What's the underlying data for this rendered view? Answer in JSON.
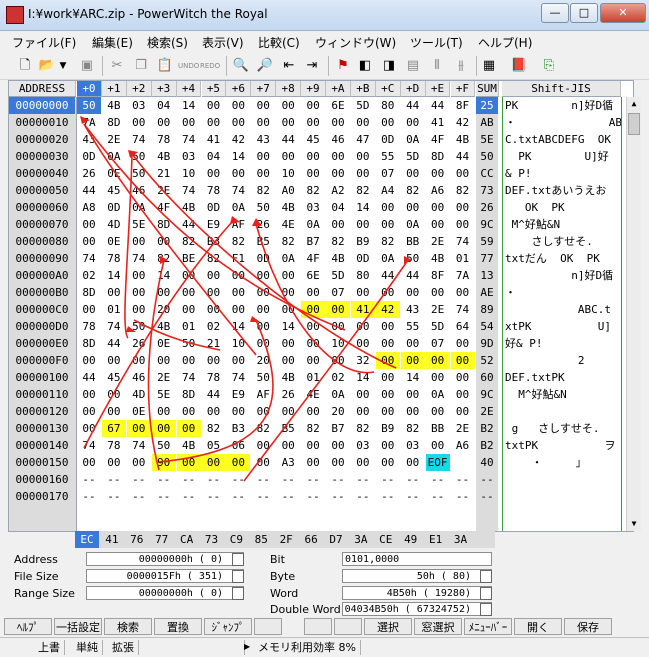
{
  "title": "I:¥work¥ARC.zip - PowerWitch the Royal",
  "window_buttons": [
    "—",
    "□",
    "✕"
  ],
  "menu": [
    "ファイル(F)",
    "編集(E)",
    "検索(S)",
    "表示(V)",
    "比較(C)",
    "ウィンドウ(W)",
    "ツール(T)",
    "ヘルプ(H)"
  ],
  "toolbar_icons": [
    "new-file-icon",
    "open-file-icon",
    "dropdown-icon",
    "save-icon",
    "cut-icon",
    "copy-icon",
    "paste-icon",
    "undo-icon",
    "redo-icon",
    "find-icon",
    "find-replace-icon",
    "find-prev-icon",
    "find-next-icon",
    "bookmark-add-icon",
    "bookmark-prev-icon",
    "bookmark-next-icon",
    "bookmark-clear-icon",
    "compare-icon",
    "compare-next-icon",
    "calculator-icon",
    "book-icon",
    "exit-icon"
  ],
  "undo_label": "UNDO",
  "redo_label": "REDO",
  "header": {
    "address": "ADDRESS",
    "columns": [
      "+0",
      "+1",
      "+2",
      "+3",
      "+4",
      "+5",
      "+6",
      "+7",
      "+8",
      "+9",
      "+A",
      "+B",
      "+C",
      "+D",
      "+E",
      "+F"
    ],
    "sum": "SUM",
    "sjis": "Shift-JIS"
  },
  "rows": [
    {
      "addr": "00000000",
      "bytes": [
        "50",
        "4B",
        "03",
        "04",
        "14",
        "00",
        "00",
        "00",
        "00",
        "00",
        "6E",
        "5D",
        "80",
        "44",
        "44",
        "8F"
      ],
      "sum": "25",
      "sjis": "PK        n]好D循"
    },
    {
      "addr": "00000010",
      "bytes": [
        "7A",
        "8D",
        "00",
        "00",
        "00",
        "00",
        "00",
        "00",
        "00",
        "00",
        "00",
        "00",
        "00",
        "00",
        "41",
        "42"
      ],
      "sum": "AB",
      "sjis": "・              AB"
    },
    {
      "addr": "00000020",
      "bytes": [
        "43",
        "2E",
        "74",
        "78",
        "74",
        "41",
        "42",
        "43",
        "44",
        "45",
        "46",
        "47",
        "0D",
        "0A",
        "4F",
        "4B"
      ],
      "sum": "5E",
      "sjis": "C.txtABCDEFG  OK"
    },
    {
      "addr": "00000030",
      "bop": "",
      "bytes": [
        "0D",
        "0A",
        "50",
        "4B",
        "03",
        "04",
        "14",
        "00",
        "00",
        "00",
        "00",
        "00",
        "55",
        "5D",
        "8D",
        "44"
      ],
      "sum": "50",
      "sjis": "  PK        U]好"
    },
    {
      "addr": "00000040",
      "bytes": [
        "26",
        "0E",
        "50",
        "21",
        "10",
        "00",
        "00",
        "00",
        "10",
        "00",
        "00",
        "00",
        "07",
        "00",
        "00",
        "00"
      ],
      "sum": "CC",
      "sjis": "& P!"
    },
    {
      "addr": "00000050",
      "bytes": [
        "44",
        "45",
        "46",
        "2E",
        "74",
        "78",
        "74",
        "82",
        "A0",
        "82",
        "A2",
        "82",
        "A4",
        "82",
        "A6",
        "82"
      ],
      "sum": "73",
      "sjis": "DEF.txtあいうえお"
    },
    {
      "addr": "00000060",
      "bytes": [
        "A8",
        "0D",
        "0A",
        "4F",
        "4B",
        "0D",
        "0A",
        "50",
        "4B",
        "03",
        "04",
        "14",
        "00",
        "00",
        "00",
        "00"
      ],
      "sum": "26",
      "sjis": "   OK  PK"
    },
    {
      "addr": "00000070",
      "bytes": [
        "00",
        "4D",
        "5E",
        "8D",
        "44",
        "E9",
        "AF",
        "26",
        "4E",
        "0A",
        "00",
        "00",
        "00",
        "0A",
        "00",
        "00"
      ],
      "sum": "9C",
      "sjis": " M^好鮎&N"
    },
    {
      "addr": "00000080",
      "bytes": [
        "00",
        "0E",
        "00",
        "00",
        "82",
        "B3",
        "82",
        "B5",
        "82",
        "B7",
        "82",
        "B9",
        "82",
        "BB",
        "2E",
        "74"
      ],
      "sum": "59",
      "sjis": "    さしすせそ."
    },
    {
      "addr": "00000090",
      "bytes": [
        "74",
        "78",
        "74",
        "82",
        "BE",
        "82",
        "F1",
        "0D",
        "0A",
        "4F",
        "4B",
        "0D",
        "0A",
        "50",
        "4B",
        "01"
      ],
      "sum": "77",
      "sjis": "txtだん  OK  PK"
    },
    {
      "addr": "000000A0",
      "bytes": [
        "02",
        "14",
        "00",
        "14",
        "00",
        "00",
        "00",
        "00",
        "00",
        "6E",
        "5D",
        "80",
        "44",
        "44",
        "8F",
        "7A"
      ],
      "sum": "13",
      "sjis": "          n]好D循"
    },
    {
      "addr": "000000B0",
      "bytes": [
        "8D",
        "00",
        "00",
        "00",
        "00",
        "00",
        "00",
        "00",
        "00",
        "00",
        "07",
        "00",
        "00",
        "00",
        "00",
        "00"
      ],
      "sum": "AE",
      "sjis": "・"
    },
    {
      "addr": "000000C0",
      "bytes": [
        "00",
        "01",
        "00",
        "20",
        "00",
        "00",
        "00",
        "00",
        "00",
        "00",
        "00",
        "41",
        "42",
        "43",
        "2E",
        "74"
      ],
      "sum": "89",
      "sjis": "           ABC.t"
    },
    {
      "addr": "000000D0",
      "bytes": [
        "78",
        "74",
        "50",
        "4B",
        "01",
        "02",
        "14",
        "00",
        "14",
        "00",
        "00",
        "00",
        "00",
        "55",
        "5D",
        "64"
      ],
      "sum": "54",
      "sjis": "xtPK          U]"
    },
    {
      "addr": "000000E0",
      "bytes": [
        "8D",
        "44",
        "26",
        "0E",
        "50",
        "21",
        "10",
        "00",
        "00",
        "00",
        "10",
        "00",
        "00",
        "00",
        "07",
        "00"
      ],
      "sum": "9D",
      "sjis": "好& P!"
    },
    {
      "addr": "000000F0",
      "bytes": [
        "00",
        "00",
        "00",
        "00",
        "00",
        "00",
        "00",
        "20",
        "00",
        "00",
        "00",
        "32",
        "00",
        "00",
        "00",
        "00"
      ],
      "sum": "52",
      "sjis": "           2"
    },
    {
      "addr": "00000100",
      "bytes": [
        "44",
        "45",
        "46",
        "2E",
        "74",
        "78",
        "74",
        "50",
        "4B",
        "01",
        "02",
        "14",
        "00",
        "14",
        "00",
        "00"
      ],
      "sum": "60",
      "sjis": "DEF.txtPK"
    },
    {
      "addr": "00000110",
      "bytes": [
        "00",
        "00",
        "4D",
        "5E",
        "8D",
        "44",
        "E9",
        "AF",
        "26",
        "4E",
        "0A",
        "00",
        "00",
        "00",
        "0A",
        "00"
      ],
      "sum": "9C",
      "sjis": "  M^好鮎&N"
    },
    {
      "addr": "00000120",
      "bytes": [
        "00",
        "00",
        "0E",
        "00",
        "00",
        "00",
        "00",
        "00",
        "00",
        "00",
        "20",
        "00",
        "00",
        "00",
        "00",
        "00"
      ],
      "sum": "2E",
      "sjis": ""
    },
    {
      "addr": "00000130",
      "bytes": [
        "00",
        "67",
        "00",
        "00",
        "00",
        "82",
        "B3",
        "82",
        "B5",
        "82",
        "B7",
        "82",
        "B9",
        "82",
        "BB",
        "2E"
      ],
      "sum": "B2",
      "sjis": " g   さしすせそ."
    },
    {
      "addr": "00000140",
      "bytes": [
        "74",
        "78",
        "74",
        "50",
        "4B",
        "05",
        "06",
        "00",
        "00",
        "00",
        "00",
        "03",
        "00",
        "03",
        "00",
        "A6"
      ],
      "sum": "B2",
      "sjis": "txtPK          ヲ"
    },
    {
      "addr": "00000150",
      "bytes": [
        "00",
        "00",
        "00",
        "90",
        "00",
        "00",
        "00",
        "00",
        "A3",
        "00",
        "00",
        "00",
        "00",
        "00",
        "EOF",
        ""
      ],
      "sum": "40",
      "sjis": "    ・     」"
    },
    {
      "addr": "00000160",
      "bytes": [
        "--",
        "--",
        "--",
        "--",
        "--",
        "--",
        "--",
        "--",
        "--",
        "--",
        "--",
        "--",
        "--",
        "--",
        "--",
        "--"
      ],
      "sum": "--",
      "sjis": ""
    },
    {
      "addr": "00000170",
      "bytes": [
        "--",
        "--",
        "--",
        "--",
        "--",
        "--",
        "--",
        "--",
        "--",
        "--",
        "--",
        "--",
        "--",
        "--",
        "--",
        "--"
      ],
      "sum": "--",
      "sjis": ""
    }
  ],
  "column_sums": [
    "EC",
    "41",
    "76",
    "77",
    "CA",
    "73",
    "C9",
    "85",
    "2F",
    "66",
    "D7",
    "3A",
    "CE",
    "49",
    "E1",
    "3A"
  ],
  "info": {
    "address_label": "Address",
    "address_value": "00000000h (          0)",
    "filesize_label": "File Size",
    "filesize_value": "0000015Fh (        351)",
    "range_label": "Range Size",
    "range_value": "00000000h (          0)",
    "bit_label": "Bit",
    "bit_value": "0101,0000",
    "byte_label": "Byte",
    "byte_value": "50h (         80)",
    "word_label": "Word",
    "word_value": "4B50h (      19280)",
    "dword_label": "Double Word",
    "dword_value": "04034B50h (   67324752)"
  },
  "function_keys": [
    "ﾍﾙﾌﾟ",
    "一括設定",
    "検索",
    "置換",
    "ｼﾞｬﾝﾌﾟ",
    "",
    "",
    "",
    "選択",
    "窓選択",
    "ﾒﾆｭｰﾊﾞｰ",
    "開く",
    "保存"
  ],
  "status": [
    "上書",
    "単純",
    "拡張",
    "",
    "メモリ利用効率 8%"
  ],
  "colors": {
    "selection": "#3a79d8",
    "highlight": "#ffff22",
    "eof": "#1ad8e8",
    "annotation": "#e8231e"
  }
}
